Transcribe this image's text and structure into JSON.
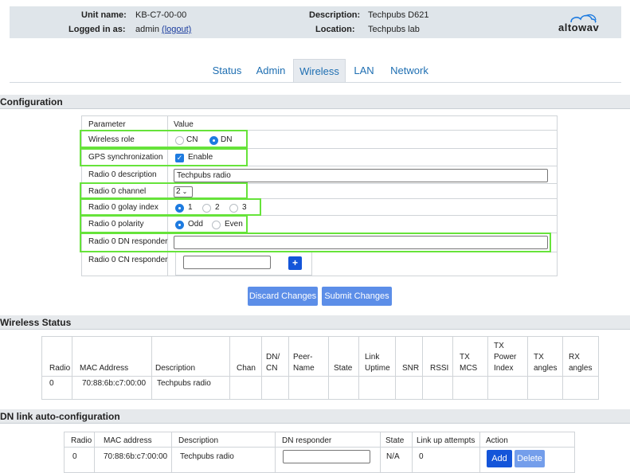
{
  "header": {
    "unit_name_label": "Unit name:",
    "unit_name_value": "KB-C7-00-00",
    "logged_in_label": "Logged in as:",
    "logged_in_user": "admin",
    "logout_link": "(logout)",
    "description_label": "Description:",
    "description_value": "Techpubs D621",
    "location_label": "Location:",
    "location_value": "Techpubs lab",
    "logo_text": "altowav",
    "logo_icon": "cloud-wave-icon"
  },
  "tabs": [
    {
      "label": "Status"
    },
    {
      "label": "Admin"
    },
    {
      "label": "Wireless",
      "active": true
    },
    {
      "label": "LAN"
    },
    {
      "label": "Network"
    }
  ],
  "configuration": {
    "title": "Configuration",
    "col_param": "Parameter",
    "col_value": "Value",
    "wireless_role": {
      "label": "Wireless role",
      "options": [
        "CN",
        "DN"
      ],
      "selected": "DN"
    },
    "gps_sync": {
      "label": "GPS synchronization",
      "checkbox_label": "Enable",
      "checked": true
    },
    "radio0_description": {
      "label": "Radio 0 description",
      "value": "Techpubs radio"
    },
    "radio0_channel": {
      "label": "Radio 0 channel",
      "value": "2"
    },
    "radio0_golay": {
      "label": "Radio 0 golay index",
      "options": [
        "1",
        "2",
        "3"
      ],
      "selected": "1"
    },
    "radio0_polarity": {
      "label": "Radio 0 polarity",
      "options": [
        "Odd",
        "Even"
      ],
      "selected": "Odd"
    },
    "radio0_dn_responder": {
      "label": "Radio 0 DN responder",
      "value": ""
    },
    "radio0_cn_responder": {
      "label": "Radio 0 CN responder",
      "value": "",
      "add_label": "+"
    },
    "discard_label": "Discard Changes",
    "submit_label": "Submit Changes"
  },
  "wireless_status": {
    "title": "Wireless Status",
    "headers": {
      "radio": "Radio",
      "mac": "MAC Address",
      "description": "Description",
      "chan": "Chan",
      "dncn_1": "DN/",
      "dncn_2": "CN",
      "peer_1": "Peer-",
      "peer_2": "Name",
      "state": "State",
      "uptime_1": "Link",
      "uptime_2": "Uptime",
      "snr": "SNR",
      "rssi": "RSSI",
      "txmcs_1": "TX",
      "txmcs_2": "MCS",
      "txpow_1": "TX",
      "txpow_2": "Power",
      "txpow_3": "Index",
      "txang_1": "TX",
      "txang_2": "angles",
      "rxang_1": "RX",
      "rxang_2": "angles"
    },
    "rows": [
      {
        "radio": "0",
        "mac": "70:88:6b:c7:00:00",
        "description": "Techpubs radio"
      }
    ]
  },
  "dn_auto": {
    "title": "DN link auto-configuration",
    "headers": {
      "radio": "Radio",
      "mac": "MAC address",
      "description": "Description",
      "dn_responder": "DN responder",
      "state": "State",
      "attempts": "Link up attempts",
      "action": "Action"
    },
    "rows": [
      {
        "radio": "0",
        "mac": "70:88:6b:c7:00:00",
        "description": "Techpubs radio",
        "dn_responder": "",
        "state": "N/A",
        "attempts": "0"
      }
    ],
    "add_label": "Add",
    "delete_label": "Delete"
  },
  "colors": {
    "accent": "#1e7be0",
    "highlight": "#66e33a",
    "button": "#5c8ee8",
    "header_bg": "#dfe5ea",
    "tab_text": "#1f6fb2"
  }
}
